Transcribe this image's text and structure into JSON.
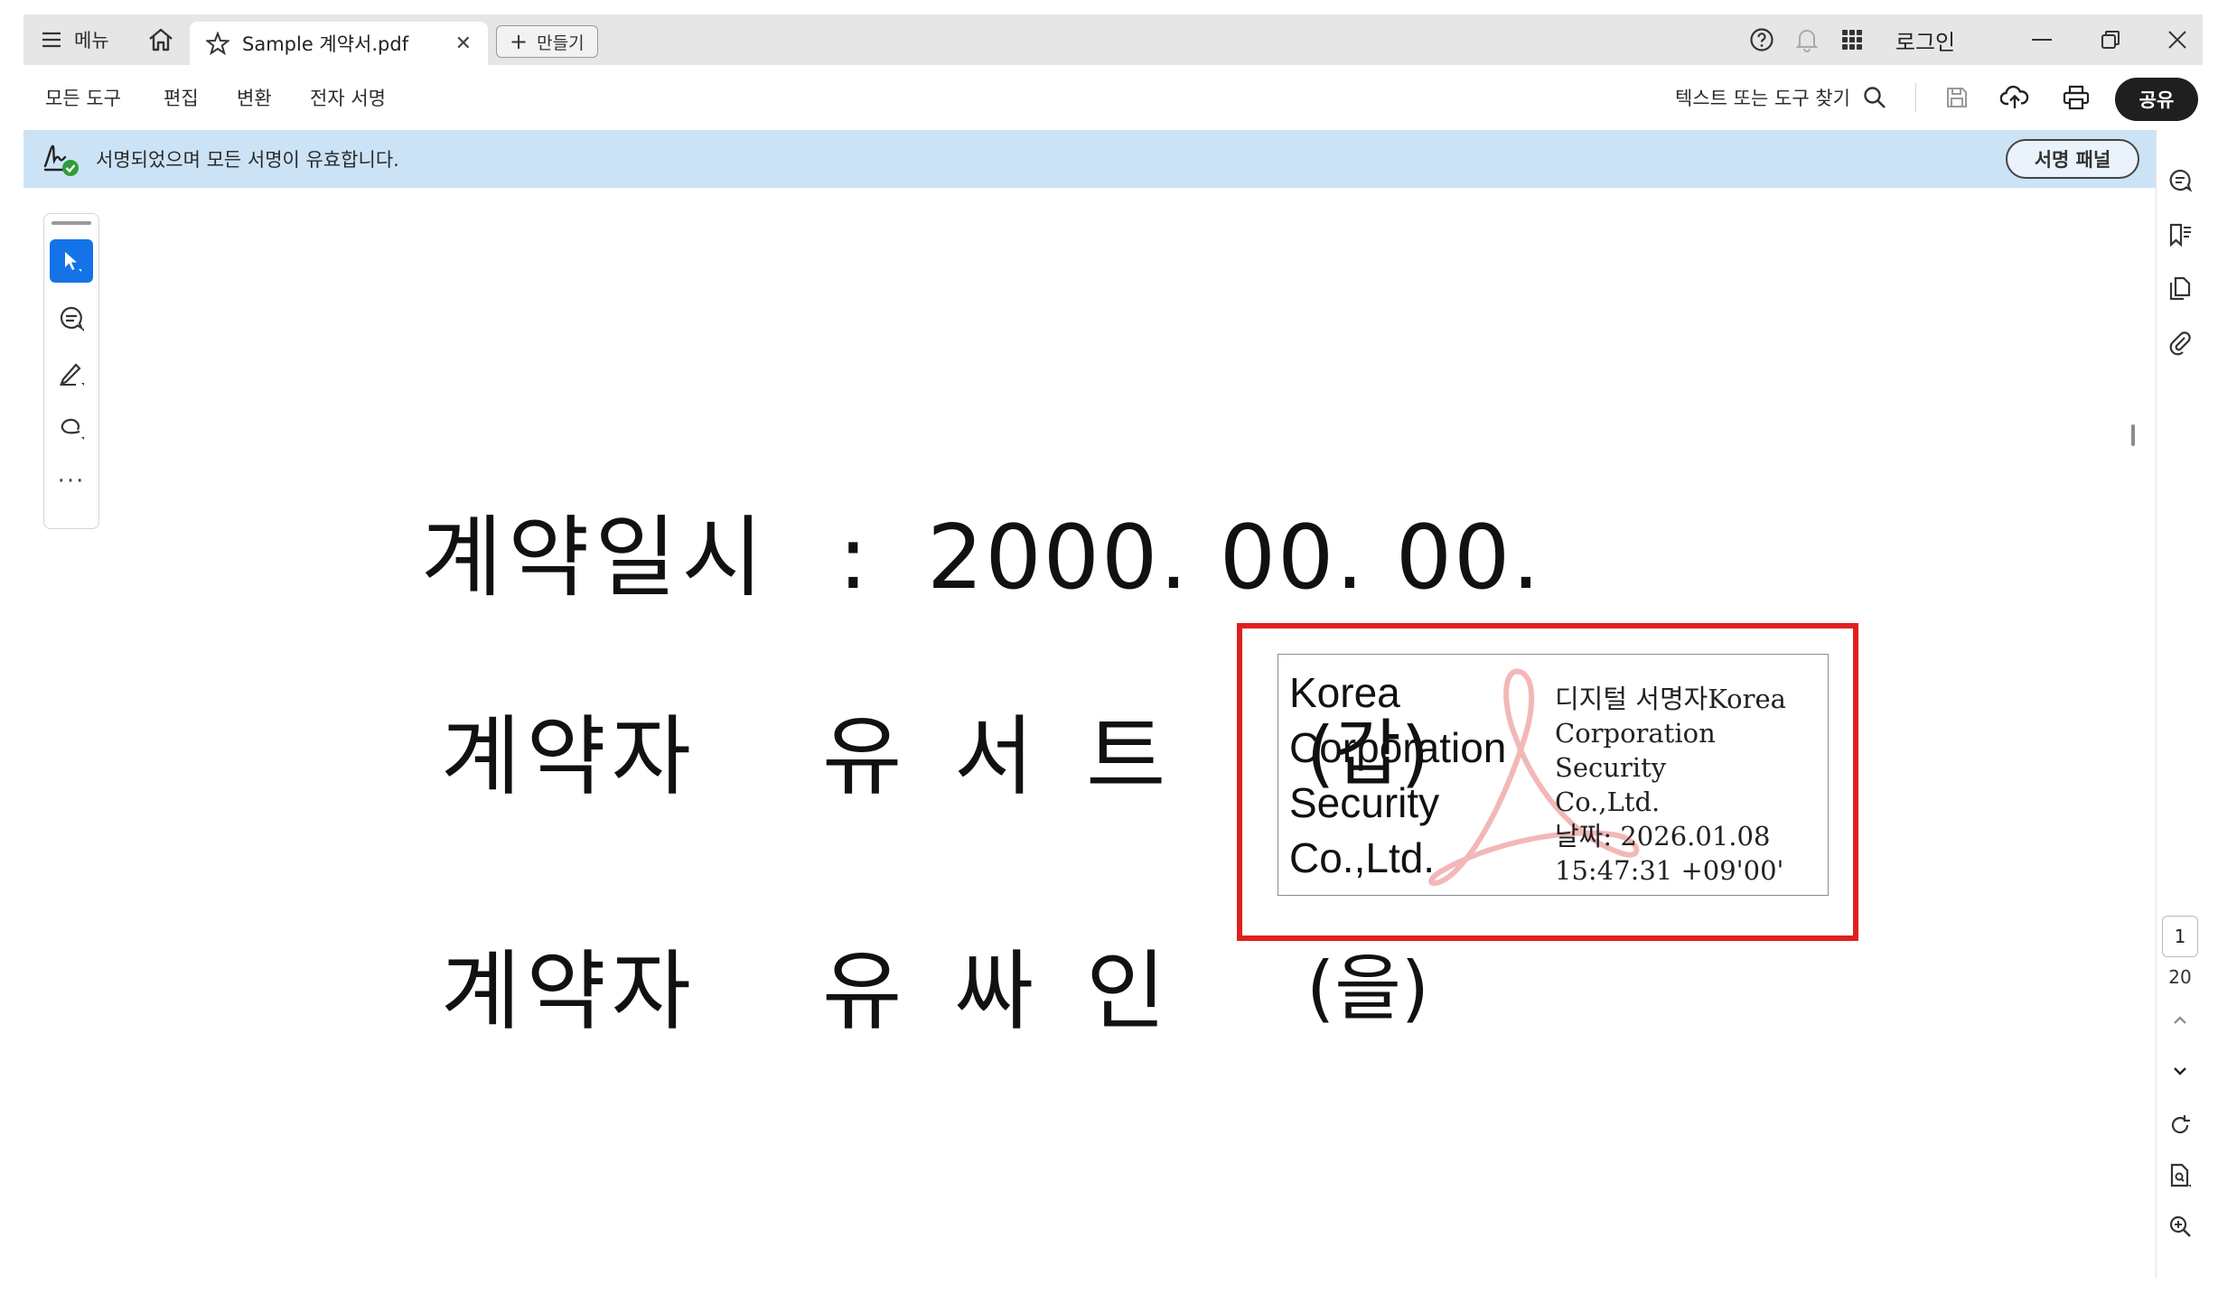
{
  "titlebar": {
    "menu_label": "메뉴",
    "tab_title": "Sample 계약서.pdf",
    "new_label": "만들기",
    "login_label": "로그인"
  },
  "toolbar": {
    "menu_items": [
      "모든 도구",
      "편집",
      "변환",
      "전자 서명"
    ],
    "find_label": "텍스트 또는 도구 찾기",
    "share_label": "공유"
  },
  "banner": {
    "message": "서명되었으며 모든 서명이 유효합니다.",
    "panel_button": "서명 패널"
  },
  "left_tools": {
    "more_label": "···"
  },
  "document": {
    "date_label": "계약일시",
    "date_sep": ":",
    "date_value": "2000. 00. 00.",
    "party1": {
      "label": "계약자",
      "name_chars": [
        "유",
        "서",
        "트"
      ],
      "role": "(갑)"
    },
    "party2": {
      "label": "계약자",
      "name_chars": [
        "유",
        "싸",
        "인"
      ],
      "role": "(을)"
    }
  },
  "signature": {
    "left_lines": [
      "Korea",
      "Corporation",
      "Security",
      "Co.,Ltd."
    ],
    "right_lines": [
      "디지털 서명자Korea",
      "Corporation Security",
      "Co.,Ltd.",
      "날짜: 2026.01.08",
      "15:47:31 +09'00'"
    ]
  },
  "page_nav": {
    "current": "1",
    "total": "20"
  },
  "colors": {
    "accent": "#1473e6",
    "banner_bg": "#cce3f6",
    "highlight": "#e02020",
    "titlebar_bg": "#e6e6e6"
  }
}
